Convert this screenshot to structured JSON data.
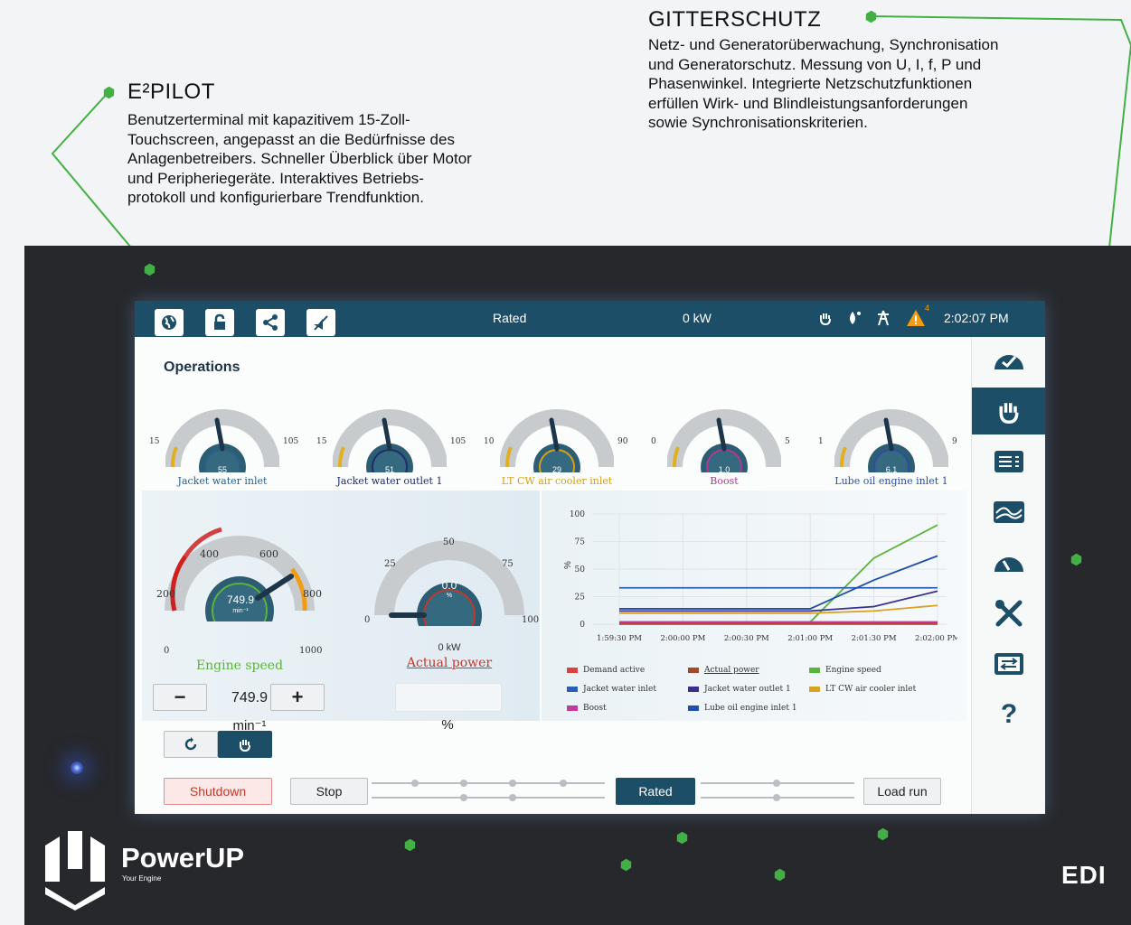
{
  "annotations": {
    "e2pilot": {
      "title": "E²PILOT",
      "text": "Benutzerterminal mit kapazitivem 15-Zoll-\nTouchscreen, angepasst an die Bedürfnisse des\nAnlagenbetreibers. Schneller Überblick über Motor\nund Peripheriegeräte. Interaktives Betriebs-\nprotokoll und konfigurierbare Trendfunktion."
    },
    "gitterschutz": {
      "title": "GITTERSCHUTZ",
      "text": "Netz- und Generatorüberwachung, Synchronisation\nund Generatorschutz. Messung von U, I, f, P und\nPhasenwinkel. Integrierte Netzschutzfunktionen\nerfüllen Wirk- und Blindleistungsanforderungen\nsowie Synchronisationskriterien."
    },
    "accent_color": "#43b045"
  },
  "branding": {
    "logo_name": "PowerUP",
    "logo_tagline": "Your Engine",
    "device_brand": "EDI"
  },
  "topbar": {
    "icons": [
      "globe-icon",
      "lock-icon",
      "share-icon",
      "mute-icon"
    ],
    "status": "Rated",
    "power": "0 kW",
    "alarm_count": "4",
    "time": "2:02:07 PM",
    "color": "#1d4e68"
  },
  "page_title": "Operations",
  "gauges": [
    {
      "label": "Jacket water inlet",
      "value": "55",
      "unit": "°C",
      "min": "15",
      "max": "105",
      "label_color": "#2c5f8a",
      "ring": "#2c5f8a"
    },
    {
      "label": "Jacket water outlet 1",
      "value": "51",
      "unit": "°C",
      "min": "15",
      "max": "105",
      "label_color": "#1f2d6b",
      "ring": "#1f2d6b"
    },
    {
      "label": "LT CW air cooler inlet",
      "value": "29",
      "unit": "°C",
      "min": "10",
      "max": "90",
      "label_color": "#d4a017",
      "ring": "#d4a017"
    },
    {
      "label": "Boost",
      "value": "1.0",
      "unit": "barm",
      "min": "0",
      "max": "5",
      "label_color": "#b0398f",
      "ring": "#b0398f"
    },
    {
      "label": "Lube oil engine inlet 1",
      "value": "6.1",
      "unit": "barg",
      "min": "1",
      "max": "9",
      "label_color": "#2d4fa0",
      "ring": "#2d4fa0"
    }
  ],
  "engine_speed": {
    "label": "Engine speed",
    "value": "749.9",
    "unit": "min⁻¹",
    "ticks": [
      "0",
      "200",
      "400",
      "600",
      "800",
      "1000"
    ],
    "setpoint": "749.9",
    "setpoint_unit": "min⁻¹",
    "minus": "−",
    "plus": "+"
  },
  "actual_power": {
    "label": "Actual power",
    "value": "0.0",
    "unit": "%",
    "sub": "0 kW",
    "ticks": [
      "0",
      "25",
      "50",
      "75",
      "100"
    ],
    "setpoint_unit": "%"
  },
  "chart_data": {
    "type": "line",
    "x": [
      "1:59:30 PM",
      "2:00:00 PM",
      "2:00:30 PM",
      "2:01:00 PM",
      "2:01:30 PM",
      "2:02:00 PM"
    ],
    "ylabel": "%",
    "yticks": [
      0,
      25,
      50,
      75,
      100
    ],
    "ylim": [
      0,
      100
    ],
    "series": [
      {
        "name": "Demand active",
        "color": "#d9433b",
        "values": [
          0,
          0,
          0,
          0,
          0,
          0
        ]
      },
      {
        "name": "Actual power",
        "color": "#a04a2c",
        "values": [
          1,
          1,
          1,
          1,
          1,
          1
        ]
      },
      {
        "name": "Engine speed",
        "color": "#5ab33a",
        "values": [
          2,
          2,
          2,
          2,
          60,
          90
        ]
      },
      {
        "name": "Jacket water inlet",
        "color": "#2c5fb0",
        "values": [
          33,
          33,
          33,
          33,
          33,
          33
        ]
      },
      {
        "name": "Jacket water outlet 1",
        "color": "#3a2f8f",
        "values": [
          12,
          12,
          12,
          12,
          16,
          30
        ]
      },
      {
        "name": "LT CW air cooler inlet",
        "color": "#d9a21f",
        "values": [
          10,
          10,
          10,
          10,
          12,
          17
        ]
      },
      {
        "name": "Boost",
        "color": "#c23a9a",
        "values": [
          2,
          2,
          2,
          2,
          2,
          2
        ]
      },
      {
        "name": "Lube oil engine inlet 1",
        "color": "#1f4fa8",
        "values": [
          14,
          14,
          14,
          14,
          40,
          62
        ]
      }
    ]
  },
  "controls": {
    "shutdown": "Shutdown",
    "stop": "Stop",
    "rated": "Rated",
    "load_run": "Load run"
  },
  "sidebar_icons": [
    "dashboard-icon",
    "hand-icon",
    "list-icon",
    "trend-icon",
    "gauge-icon",
    "tools-icon",
    "settings-icon",
    "help-icon"
  ]
}
